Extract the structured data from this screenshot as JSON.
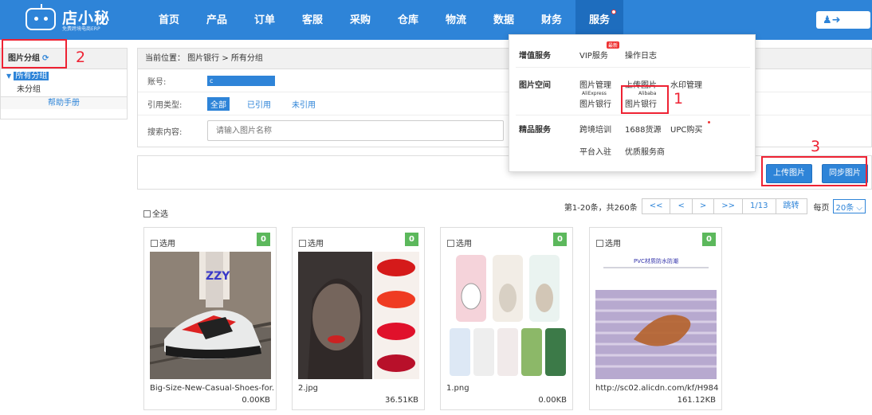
{
  "brand": {
    "name": "店小秘",
    "slogan": "免费跨境电商ERP"
  },
  "nav": [
    "首页",
    "产品",
    "订单",
    "客服",
    "采购",
    "仓库",
    "物流",
    "数据",
    "财务",
    "服务"
  ],
  "sidebar": {
    "title": "图片分组",
    "items": [
      "所有分组",
      "未分组"
    ],
    "help": "帮助手册"
  },
  "breadcrumb": "当前位置： 图片银行 > 所有分组",
  "filters": {
    "account_label": "账号:",
    "account_value": "c",
    "ref_label": "引用类型:",
    "ref_types": [
      "全部",
      "已引用",
      "未引用"
    ],
    "search_label": "搜索内容:",
    "search_placeholder": "请输入图片名称"
  },
  "actions": {
    "upload": "上传图片",
    "sync": "同步图片"
  },
  "toolbar": {
    "select_all": "全选",
    "page_info": "第1-20条，共260条",
    "pager": [
      "<<",
      "<",
      ">",
      ">>"
    ],
    "page": "1/13",
    "jump": "跳转",
    "per_page_label": "每页",
    "per_page": "20条"
  },
  "cards": [
    {
      "select": "选用",
      "count": "0",
      "name": "Big-Size-New-Casual-Shoes-for...",
      "size": "0.00KB"
    },
    {
      "select": "选用",
      "count": "0",
      "name": "2.jpg",
      "size": "36.51KB"
    },
    {
      "select": "选用",
      "count": "0",
      "name": "1.png",
      "size": "0.00KB"
    },
    {
      "select": "选用",
      "count": "0",
      "name": "http://sc02.alicdn.com/kf/H984a...",
      "size": "161.12KB",
      "overlay": "PVC材质防水防潮"
    }
  ],
  "dropdown": {
    "value_added": {
      "title": "增值服务",
      "items": [
        "VIP服务",
        "操作日志"
      ],
      "new_tag": "最新"
    },
    "image_space": {
      "title": "图片空间",
      "items": [
        "图片管理",
        "上传图片",
        "水印管理"
      ],
      "bank_items": [
        "图片银行",
        "图片银行"
      ],
      "sub_labels": [
        "AliExpress",
        "Alibaba"
      ]
    },
    "premium": {
      "title": "精品服务",
      "items": [
        "跨境培训",
        "1688货源",
        "UPC购买"
      ],
      "items2": [
        "平台入驻",
        "优质服务商"
      ]
    }
  },
  "annotations": [
    "1",
    "2",
    "3"
  ],
  "colors": {
    "primary": "#2e84d8",
    "annotation": "#e23333",
    "badge": "#5cb85c"
  }
}
